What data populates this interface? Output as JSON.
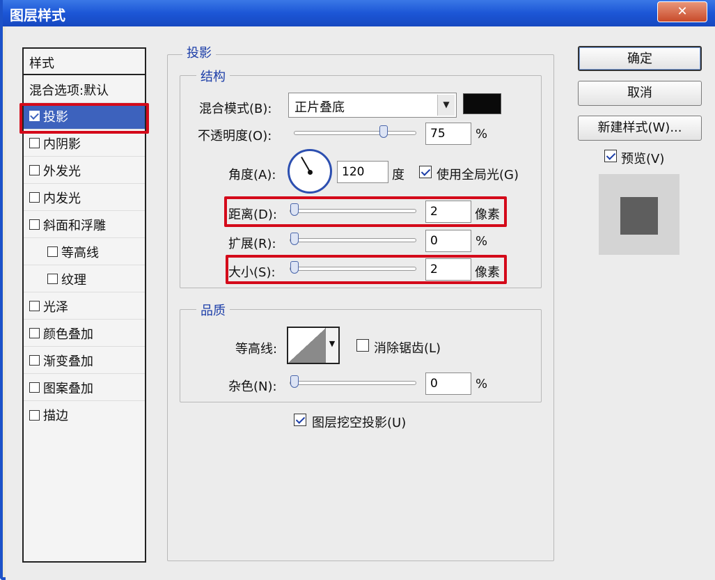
{
  "window": {
    "title": "图层样式",
    "close_glyph": "✕"
  },
  "styles_list": {
    "header": "样式",
    "blend_options": "混合选项:默认",
    "items": [
      {
        "label": "投影",
        "checked": true,
        "selected": true
      },
      {
        "label": "内阴影",
        "checked": false
      },
      {
        "label": "外发光",
        "checked": false
      },
      {
        "label": "内发光",
        "checked": false
      },
      {
        "label": "斜面和浮雕",
        "checked": false
      },
      {
        "label": "等高线",
        "checked": false,
        "indent": true
      },
      {
        "label": "纹理",
        "checked": false,
        "indent": true
      },
      {
        "label": "光泽",
        "checked": false
      },
      {
        "label": "颜色叠加",
        "checked": false
      },
      {
        "label": "渐变叠加",
        "checked": false
      },
      {
        "label": "图案叠加",
        "checked": false
      },
      {
        "label": "描边",
        "checked": false
      }
    ]
  },
  "panel": {
    "title": "投影",
    "structure": {
      "legend": "结构",
      "blend_mode": {
        "label": "混合模式(B):",
        "value": "正片叠底",
        "color": "#0a0a0a"
      },
      "opacity": {
        "label": "不透明度(O):",
        "value": "75",
        "unit": "%",
        "fraction": 0.75
      },
      "angle": {
        "label": "角度(A):",
        "value": "120",
        "unit": "度",
        "global_light": "使用全局光(G)",
        "global_checked": true
      },
      "distance": {
        "label": "距离(D):",
        "value": "2",
        "unit": "像素",
        "fraction": 0.0
      },
      "spread": {
        "label": "扩展(R):",
        "value": "0",
        "unit": "%",
        "fraction": 0.0
      },
      "size": {
        "label": "大小(S):",
        "value": "2",
        "unit": "像素",
        "fraction": 0.0
      }
    },
    "quality": {
      "legend": "品质",
      "contour": {
        "label": "等高线:",
        "antialias": "消除锯齿(L)",
        "antialias_checked": false
      },
      "noise": {
        "label": "杂色(N):",
        "value": "0",
        "unit": "%",
        "fraction": 0.0
      }
    },
    "knockout": {
      "label": "图层挖空投影(U)",
      "checked": true
    }
  },
  "buttons": {
    "ok": "确定",
    "cancel": "取消",
    "new_style": "新建样式(W)...",
    "preview": "预览(V)",
    "preview_checked": true
  }
}
